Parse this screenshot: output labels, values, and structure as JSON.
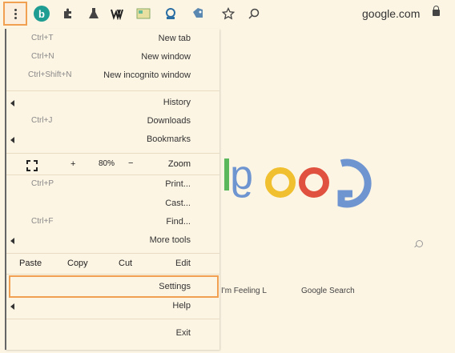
{
  "toolbar": {
    "avatar_letter": "b",
    "omnibox_text": "google.com",
    "extensions": [
      "puzzle-icon",
      "flask-icon",
      "w-icon",
      "image-icon",
      "download-icon",
      "tag-icon",
      "star-icon",
      "search-icon"
    ]
  },
  "menu": {
    "items": [
      {
        "label": "New tab",
        "shortcut": "Ctrl+T"
      },
      {
        "label": "New window",
        "shortcut": "Ctrl+N"
      },
      {
        "label": "New incognito window",
        "shortcut": "Ctrl+Shift+N"
      },
      {
        "label": "History",
        "shortcut": ""
      },
      {
        "label": "Downloads",
        "shortcut": "Ctrl+J"
      },
      {
        "label": "Bookmarks",
        "shortcut": ""
      },
      {
        "label": "Print...",
        "shortcut": "Ctrl+P"
      },
      {
        "label": "Cast...",
        "shortcut": ""
      },
      {
        "label": "Find...",
        "shortcut": "Ctrl+F"
      },
      {
        "label": "More tools",
        "shortcut": ""
      },
      {
        "label": "Settings",
        "shortcut": ""
      },
      {
        "label": "Help",
        "shortcut": ""
      },
      {
        "label": "Exit",
        "shortcut": ""
      }
    ],
    "zoom": {
      "label": "Zoom",
      "minus": "−",
      "value": "80%",
      "plus": "+"
    },
    "edit": {
      "label": "Edit",
      "cut": "Cut",
      "copy": "Copy",
      "paste": "Paste"
    }
  },
  "page": {
    "logo_text": "Googl",
    "search_button": "Google Search",
    "lucky_button": "I'm Feeling L"
  },
  "colors": {
    "accent": "#f0a050",
    "background": "#fdf5e4"
  }
}
